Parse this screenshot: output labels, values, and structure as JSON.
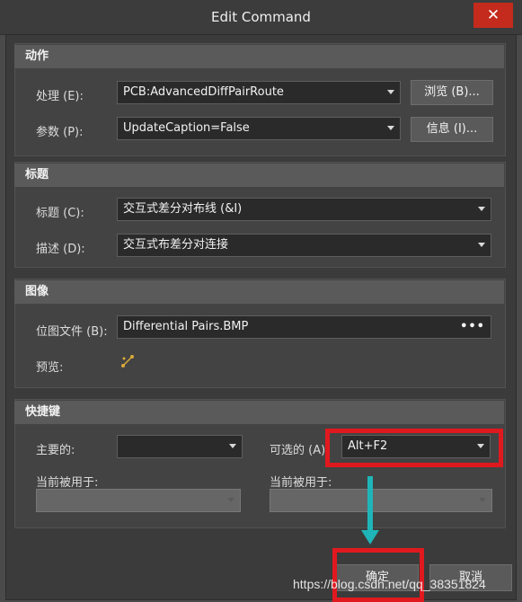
{
  "window": {
    "title": "Edit Command",
    "close_label": "✕"
  },
  "sections": {
    "action": {
      "header": "动作",
      "process_label": "处理 (E):",
      "process_value": "PCB:AdvancedDiffPairRoute",
      "browse_button": "浏览 (B)...",
      "params_label": "参数 (P):",
      "params_value": "UpdateCaption=False",
      "info_button": "信息 (I)..."
    },
    "title": {
      "header": "标题",
      "caption_label": "标题 (C):",
      "caption_value": "交互式差分对布线 (&I)",
      "desc_label": "描述 (D):",
      "desc_value": "交互式布差分对连接"
    },
    "image": {
      "header": "图像",
      "bitmap_label": "位图文件 (B):",
      "bitmap_value": "Differential Pairs.BMP",
      "bitmap_more": "•••",
      "preview_label": "预览:",
      "preview_icon": "diff-pair-icon"
    },
    "shortcuts": {
      "header": "快捷键",
      "primary_label": "主要的:",
      "primary_value": "",
      "alternate_label": "可选的 (A)",
      "alternate_value": "Alt+F2",
      "used_by_left_label": "当前被用于:",
      "used_by_right_label": "当前被用于:"
    }
  },
  "footer": {
    "ok_button": "确定",
    "cancel_button": "取消"
  },
  "watermark": "https://blog.csdn.net/qq_38351824",
  "colors": {
    "highlight": "#e0191f",
    "arrow": "#1fb5b8",
    "close": "#c42b1c"
  }
}
